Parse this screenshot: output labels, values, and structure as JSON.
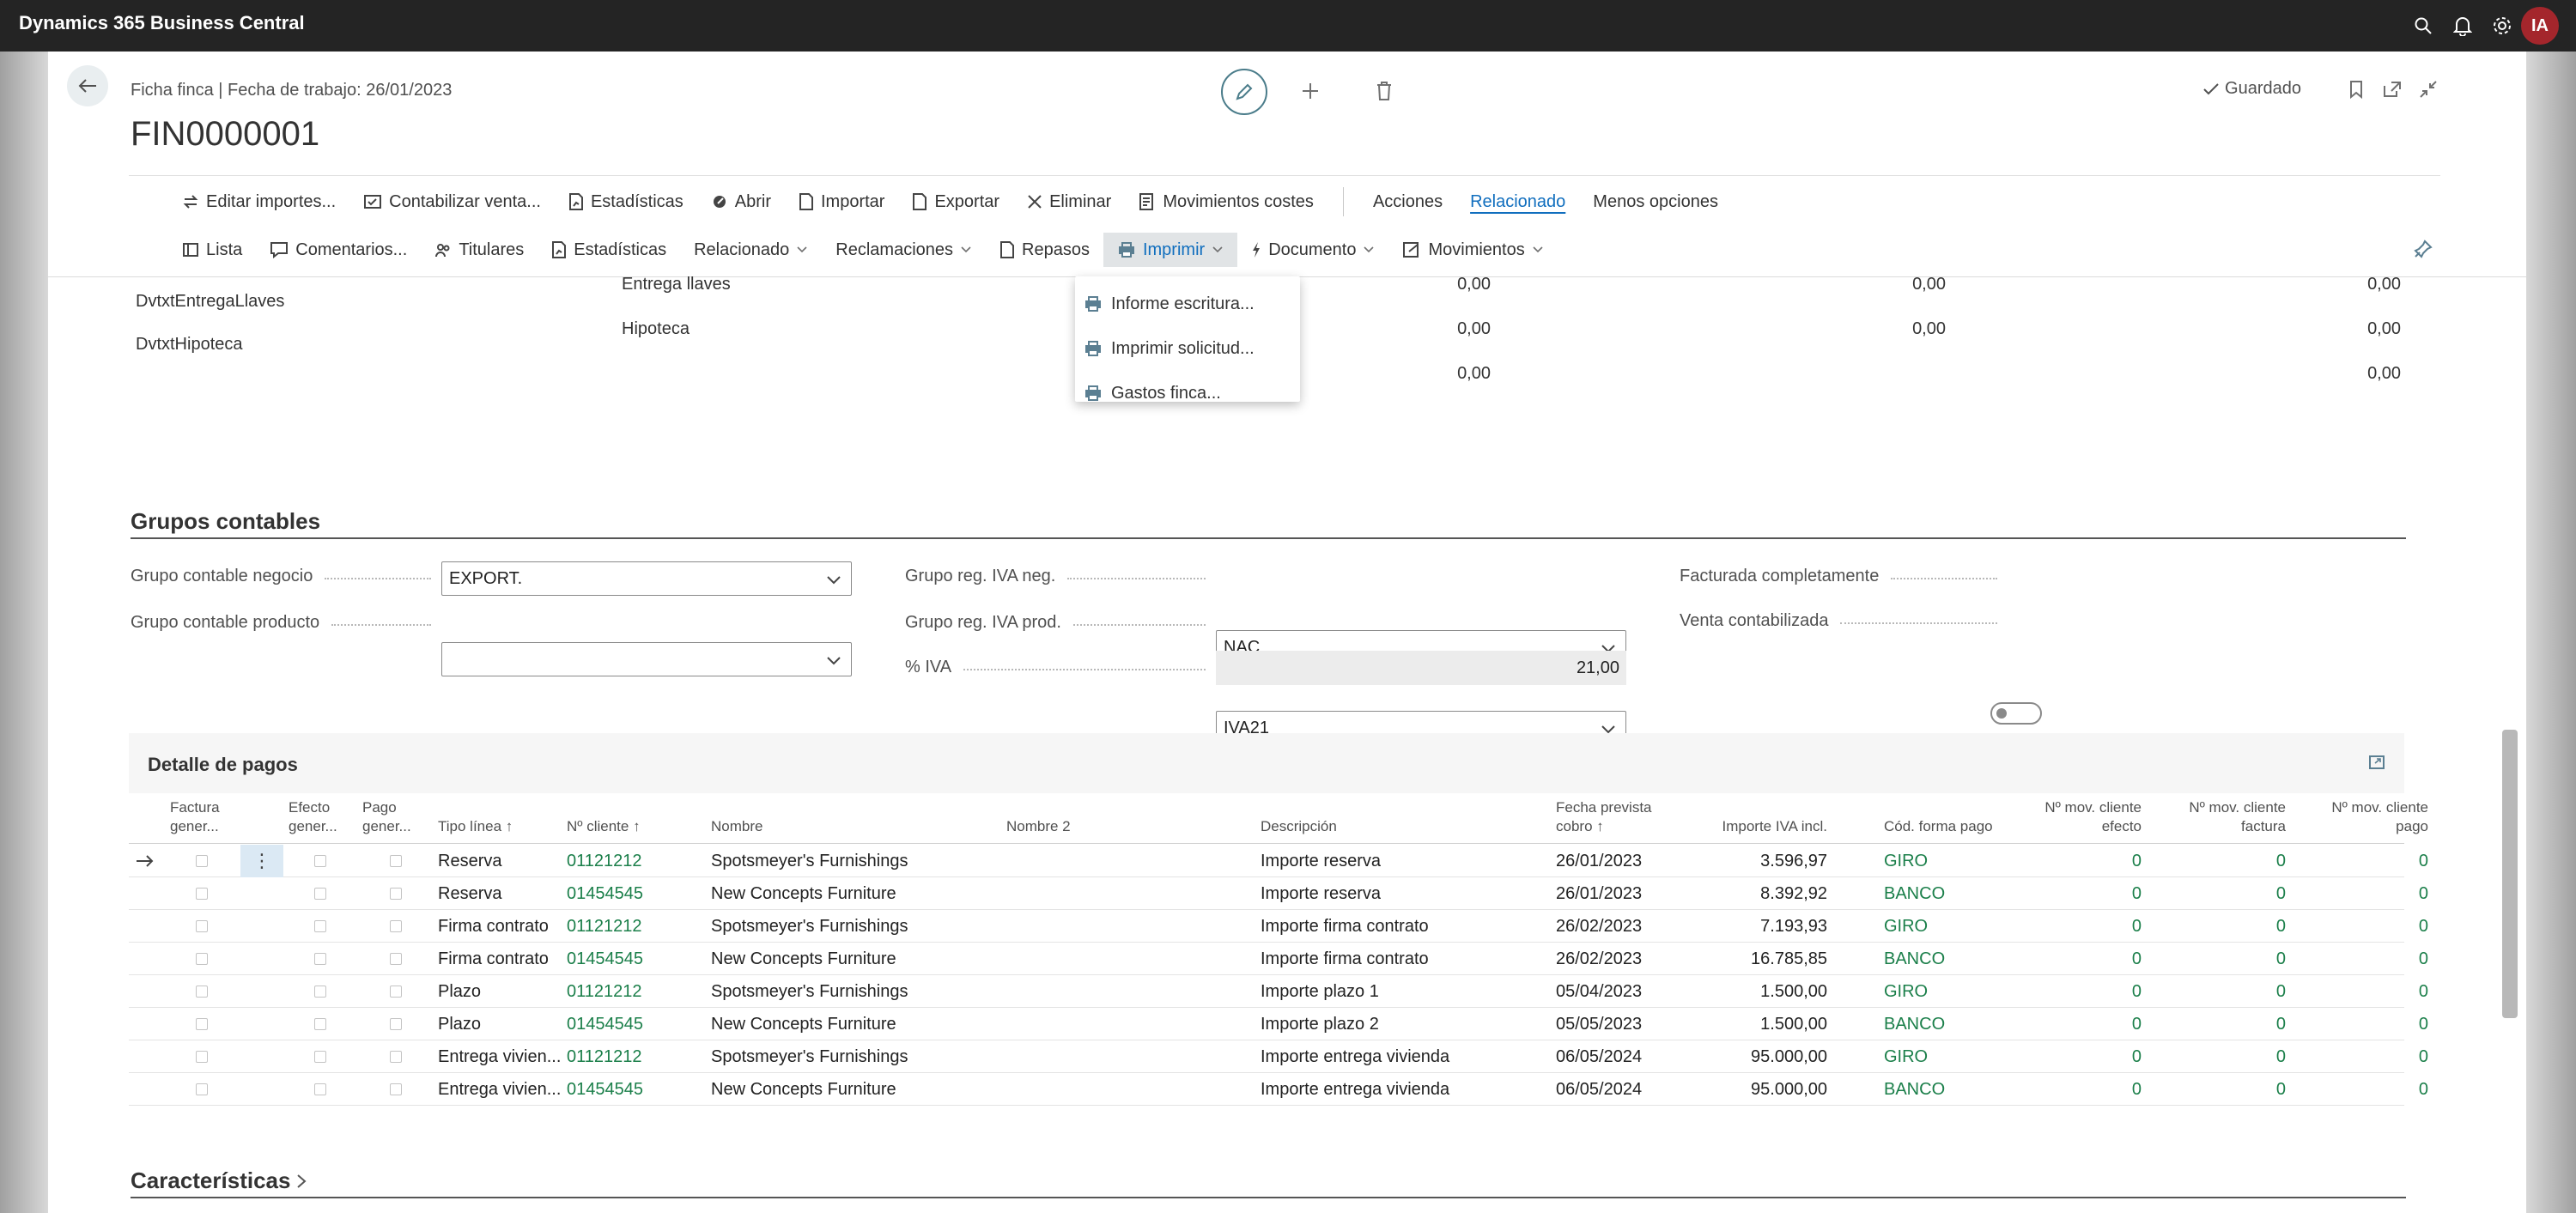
{
  "app": {
    "title": "Dynamics 365 Business Central",
    "user_initials": "IA",
    "icons": [
      "search-icon",
      "bell-icon",
      "gear-icon",
      "help-icon"
    ]
  },
  "header": {
    "breadcrumb": "Ficha finca | Fecha de trabajo: 26/01/2023",
    "title": "FIN0000001",
    "saved_label": "Guardado"
  },
  "actions": {
    "row1": [
      "Editar importes...",
      "Contabilizar venta...",
      "Estadísticas",
      "Abrir",
      "Importar",
      "Exportar",
      "Eliminar",
      "Movimientos costes"
    ],
    "acciones": "Acciones",
    "relacionado": "Relacionado",
    "menos": "Menos opciones",
    "row2": [
      "Lista",
      "Comentarios...",
      "Titulares",
      "Estadísticas",
      "Relacionado",
      "Reclamaciones",
      "Repasos",
      "Imprimir",
      "Documento",
      "Movimientos"
    ]
  },
  "print_menu": [
    "Informe escritura...",
    "Imprimir solicitud...",
    "Gastos finca..."
  ],
  "top_rows": [
    {
      "code": "DvtxtEntregaLlaves",
      "desc": "Entrega llaves",
      "v1": "0,00",
      "v2": "0,00",
      "v3": "0,00"
    },
    {
      "code": "DvtxtHipoteca",
      "desc": "Hipoteca",
      "v1": "0,00",
      "v2": "0,00",
      "v3": "0,00"
    },
    {
      "code": "",
      "desc": "",
      "v1": "0,00",
      "v2": "",
      "v3": "0,00"
    }
  ],
  "grupos": {
    "title": "Grupos contables",
    "negocio_label": "Grupo contable negocio",
    "negocio_value": "EXPORT.",
    "producto_label": "Grupo contable producto",
    "producto_value": "",
    "iva_neg_label": "Grupo reg. IVA neg.",
    "iva_neg_value": "NAC",
    "iva_prod_label": "Grupo reg. IVA prod.",
    "iva_prod_value": "IVA21",
    "iva_pct_label": "% IVA",
    "iva_pct_value": "21,00",
    "facturada_label": "Facturada completamente",
    "venta_label": "Venta contabilizada"
  },
  "pagos": {
    "title": "Detalle de pagos",
    "headers": {
      "factura": [
        "Factura",
        "gener..."
      ],
      "efecto": [
        "Efecto",
        "gener..."
      ],
      "pago": [
        "Pago",
        "gener..."
      ],
      "tipo": "Tipo línea ↑",
      "cliente": "Nº cliente ↑",
      "nombre": "Nombre",
      "nombre2": "Nombre 2",
      "descripcion": "Descripción",
      "fecha": [
        "Fecha prevista",
        "cobro ↑"
      ],
      "importe": "Importe IVA incl.",
      "forma": "Cód. forma pago",
      "mov_efecto": [
        "Nº mov. cliente",
        "efecto"
      ],
      "mov_factura": [
        "Nº mov. cliente",
        "factura"
      ],
      "mov_pago": [
        "Nº mov. cliente",
        "pago"
      ]
    },
    "rows": [
      {
        "tipo": "Reserva",
        "cliente": "01121212",
        "nombre": "Spotsmeyer's Furnishings",
        "desc": "Importe reserva",
        "fecha": "26/01/2023",
        "importe": "3.596,97",
        "forma": "GIRO",
        "m1": "0",
        "m2": "0",
        "m3": "0"
      },
      {
        "tipo": "Reserva",
        "cliente": "01454545",
        "nombre": "New Concepts Furniture",
        "desc": "Importe reserva",
        "fecha": "26/01/2023",
        "importe": "8.392,92",
        "forma": "BANCO",
        "m1": "0",
        "m2": "0",
        "m3": "0"
      },
      {
        "tipo": "Firma contrato",
        "cliente": "01121212",
        "nombre": "Spotsmeyer's Furnishings",
        "desc": "Importe firma contrato",
        "fecha": "26/02/2023",
        "importe": "7.193,93",
        "forma": "GIRO",
        "m1": "0",
        "m2": "0",
        "m3": "0"
      },
      {
        "tipo": "Firma contrato",
        "cliente": "01454545",
        "nombre": "New Concepts Furniture",
        "desc": "Importe firma contrato",
        "fecha": "26/02/2023",
        "importe": "16.785,85",
        "forma": "BANCO",
        "m1": "0",
        "m2": "0",
        "m3": "0"
      },
      {
        "tipo": "Plazo",
        "cliente": "01121212",
        "nombre": "Spotsmeyer's Furnishings",
        "desc": "Importe plazo 1",
        "fecha": "05/04/2023",
        "importe": "1.500,00",
        "forma": "GIRO",
        "m1": "0",
        "m2": "0",
        "m3": "0"
      },
      {
        "tipo": "Plazo",
        "cliente": "01454545",
        "nombre": "New Concepts Furniture",
        "desc": "Importe plazo 2",
        "fecha": "05/05/2023",
        "importe": "1.500,00",
        "forma": "BANCO",
        "m1": "0",
        "m2": "0",
        "m3": "0"
      },
      {
        "tipo": "Entrega vivien...",
        "cliente": "01121212",
        "nombre": "Spotsmeyer's Furnishings",
        "desc": "Importe entrega vivienda",
        "fecha": "06/05/2024",
        "importe": "95.000,00",
        "forma": "GIRO",
        "m1": "0",
        "m2": "0",
        "m3": "0"
      },
      {
        "tipo": "Entrega vivien...",
        "cliente": "01454545",
        "nombre": "New Concepts Furniture",
        "desc": "Importe entrega vivienda",
        "fecha": "06/05/2024",
        "importe": "95.000,00",
        "forma": "BANCO",
        "m1": "0",
        "m2": "0",
        "m3": "0"
      }
    ]
  },
  "caracteristicas": {
    "title": "Características"
  },
  "colors": {
    "topbar": "#242424",
    "accent": "#106ebe",
    "link": "#1b7f4a",
    "avatar": "#a4262c"
  }
}
